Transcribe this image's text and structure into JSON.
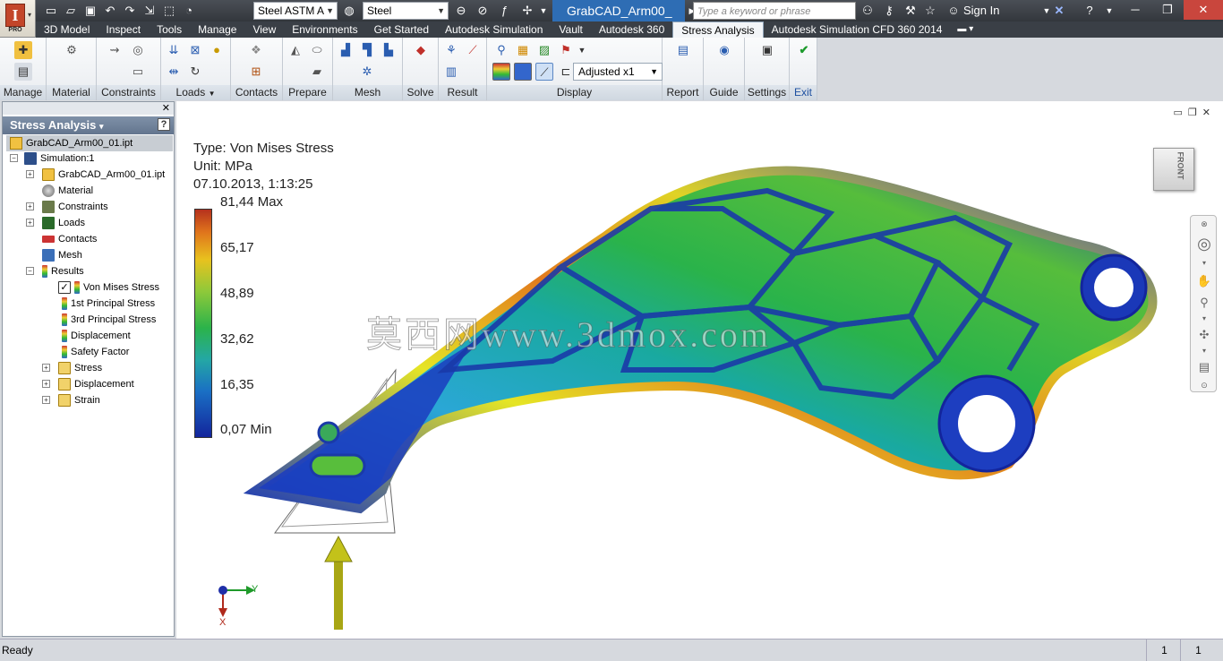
{
  "titlebar": {
    "app_logo": "I",
    "app_edition": "PRO",
    "material_combo": "Steel ASTM A",
    "appearance_combo": "Steel",
    "document_title": "GrabCAD_Arm00_",
    "search_placeholder": "Type a keyword or phrase",
    "signin_label": "Sign In"
  },
  "tabs": [
    {
      "label": "3D Model"
    },
    {
      "label": "Inspect"
    },
    {
      "label": "Tools"
    },
    {
      "label": "Manage"
    },
    {
      "label": "View"
    },
    {
      "label": "Environments"
    },
    {
      "label": "Get Started"
    },
    {
      "label": "Autodesk Simulation"
    },
    {
      "label": "Vault"
    },
    {
      "label": "Autodesk 360"
    },
    {
      "label": "Stress Analysis",
      "active": true
    },
    {
      "label": "Autodesk Simulation CFD 360 2014"
    }
  ],
  "ribbon": {
    "groups": [
      {
        "label": "Manage"
      },
      {
        "label": "Material"
      },
      {
        "label": "Constraints"
      },
      {
        "label": "Loads"
      },
      {
        "label": "Contacts"
      },
      {
        "label": "Prepare"
      },
      {
        "label": "Mesh"
      },
      {
        "label": "Solve"
      },
      {
        "label": "Result"
      },
      {
        "label": "Display"
      },
      {
        "label": "Report"
      },
      {
        "label": "Guide"
      },
      {
        "label": "Settings"
      },
      {
        "label": "Exit"
      }
    ],
    "display_scale": "Adjusted x1",
    "loads_dropdown": "▼"
  },
  "browser": {
    "header": "Stress Analysis",
    "help": "?",
    "root": "GrabCAD_Arm00_01.ipt",
    "nodes": [
      {
        "label": "Simulation:1"
      },
      {
        "label": "GrabCAD_Arm00_01.ipt"
      },
      {
        "label": "Material"
      },
      {
        "label": "Constraints"
      },
      {
        "label": "Loads"
      },
      {
        "label": "Contacts"
      },
      {
        "label": "Mesh"
      },
      {
        "label": "Results"
      },
      {
        "label": "Von Mises Stress"
      },
      {
        "label": "1st Principal Stress"
      },
      {
        "label": "3rd Principal Stress"
      },
      {
        "label": "Displacement"
      },
      {
        "label": "Safety Factor"
      },
      {
        "label": "Stress"
      },
      {
        "label": "Displacement"
      },
      {
        "label": "Strain"
      }
    ]
  },
  "viewport": {
    "result_type": "Type: Von Mises Stress",
    "unit": "Unit: MPa",
    "timestamp": "07.10.2013, 1:13:25",
    "legend_ticks": [
      "81,44 Max",
      "65,17",
      "48,89",
      "32,62",
      "16,35",
      "0,07 Min"
    ],
    "legend_colors": [
      "#b5311d",
      "#e0751c",
      "#e8c21e",
      "#8ec93a",
      "#2bb34a",
      "#24a7a5",
      "#1a6fc4",
      "#13259c"
    ],
    "viewcube_face": "FRONT",
    "axis_y": "Y",
    "axis_x": "X",
    "watermark": "莫西网www.3dmox.com"
  },
  "statusbar": {
    "text": "Ready",
    "num1": "1",
    "num2": "1"
  }
}
